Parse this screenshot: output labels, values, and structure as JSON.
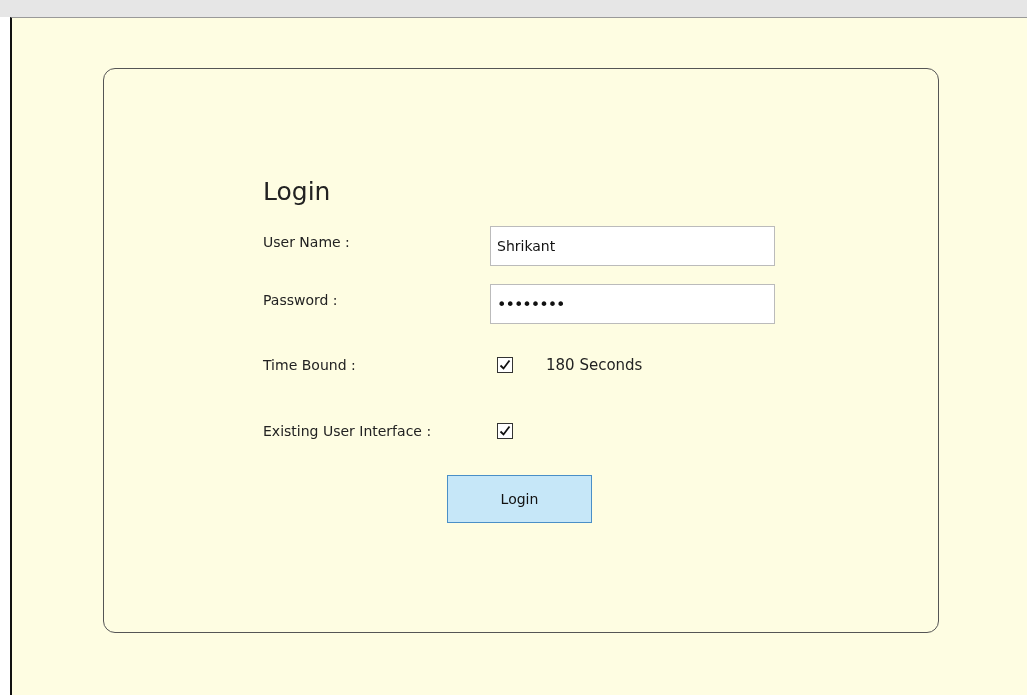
{
  "form": {
    "title": "Login",
    "fields": [
      {
        "kind": "text",
        "label": "User Name :",
        "value": "Shrikant"
      },
      {
        "kind": "password",
        "label": "Password :",
        "value": "••••••••"
      },
      {
        "kind": "checkbox",
        "label": "Time Bound :",
        "checked": true,
        "note": "180 Seconds"
      },
      {
        "kind": "checkbox",
        "label": "Existing User Interface :",
        "checked": true
      }
    ],
    "button": "Login"
  }
}
